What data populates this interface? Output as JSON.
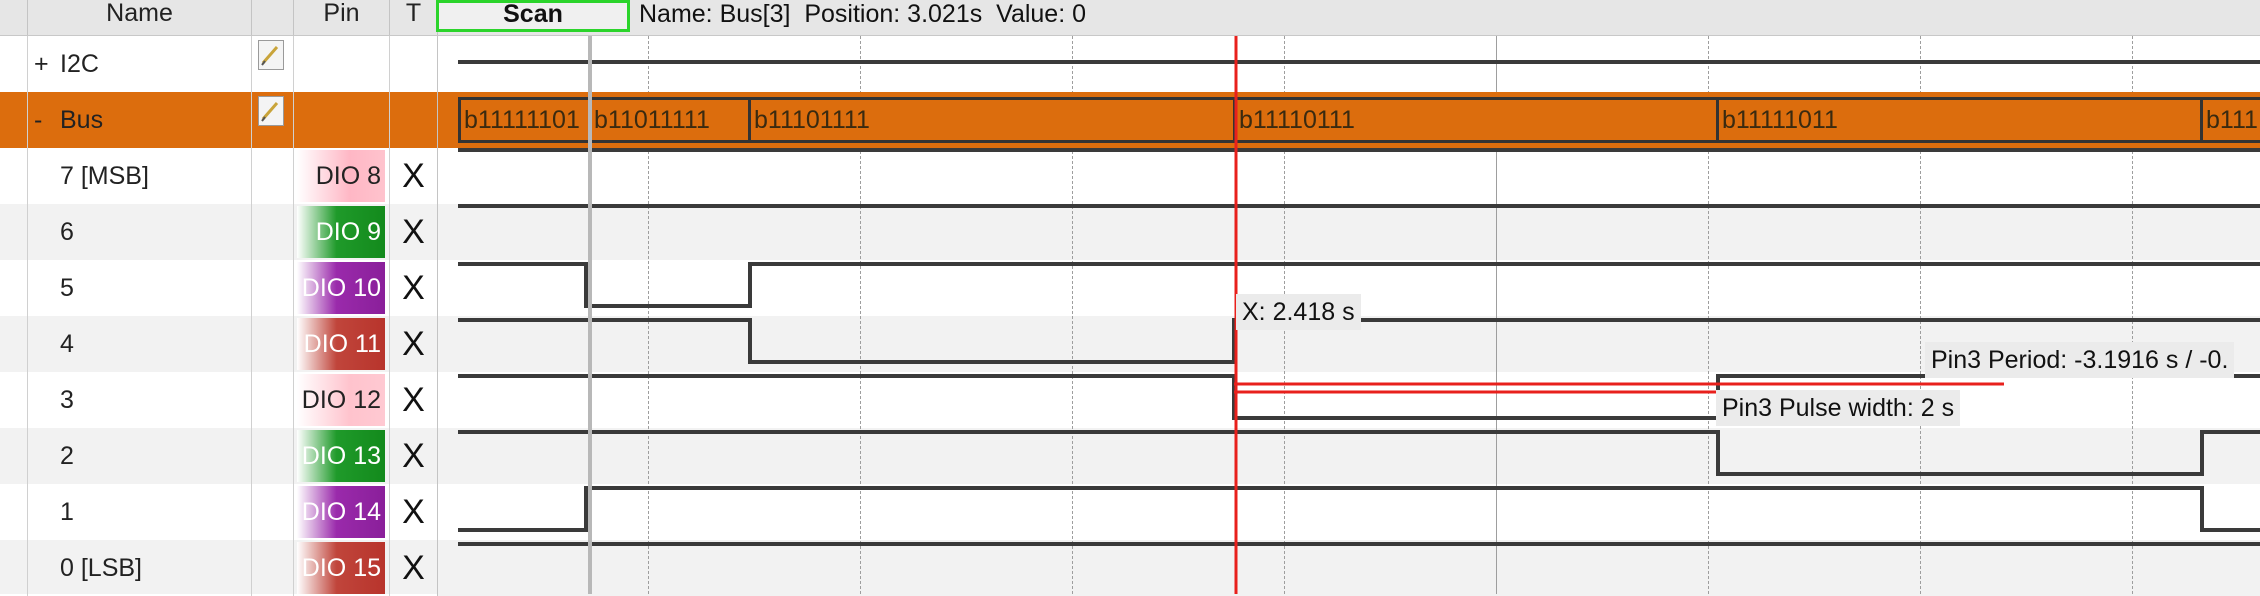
{
  "header": {
    "name_label": "Name",
    "pin_label": "Pin",
    "t_label": "T",
    "scan_label": "Scan",
    "status": "Name: Bus[3]  Position: 3.021s  Value: 0"
  },
  "rows": [
    {
      "sign": "+",
      "label": "I2C",
      "pin": "",
      "t": "",
      "group": true
    },
    {
      "sign": "-",
      "label": "Bus",
      "pin": "",
      "t": "",
      "group": true
    },
    {
      "sign": "",
      "label": "7 [MSB]",
      "pin": "DIO  8",
      "t": "X"
    },
    {
      "sign": "",
      "label": "6",
      "pin": "DIO  9",
      "t": "X"
    },
    {
      "sign": "",
      "label": "5",
      "pin": "DIO 10",
      "t": "X"
    },
    {
      "sign": "",
      "label": "4",
      "pin": "DIO 11",
      "t": "X"
    },
    {
      "sign": "",
      "label": "3",
      "pin": "DIO 12",
      "t": "X"
    },
    {
      "sign": "",
      "label": "2",
      "pin": "DIO 13",
      "t": "X"
    },
    {
      "sign": "",
      "label": "1",
      "pin": "DIO 14",
      "t": "X"
    },
    {
      "sign": "",
      "label": "0 [LSB]",
      "pin": "DIO 15",
      "t": "X"
    }
  ],
  "bus_values": [
    "b11111101",
    "b11011111",
    "b11101111",
    "b11110111",
    "b11111011",
    "b111"
  ],
  "annotations": {
    "cursor_x": "X: 2.418 s",
    "pulse_width": "Pin3 Pulse width: 2 s",
    "period": "Pin3 Period: -3.1916 s / -0."
  },
  "colors": {
    "bus_fill": "#dc6d0d",
    "cursor": "#e8201c",
    "scan_border": "#2bd42b",
    "pin_red": "#b8342c",
    "pin_green": "#138a1c",
    "pin_purple": "#8a1f9a"
  },
  "icons": {
    "edit": "edit-icon",
    "expand": "plus-sign",
    "collapse": "minus-sign",
    "trigger": "x-glyph"
  }
}
